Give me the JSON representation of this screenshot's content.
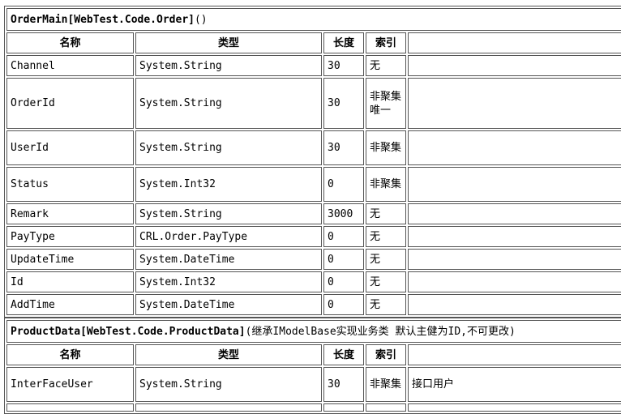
{
  "tables": [
    {
      "title_name": "OrderMain[WebTest.Code.Order]",
      "title_suffix": "()",
      "headers": [
        "名称",
        "类型",
        "长度",
        "索引",
        ""
      ],
      "rows": [
        {
          "name": "Channel",
          "type": "System.String",
          "length": "30",
          "index": "无",
          "note": ""
        },
        {
          "name": "OrderId",
          "type": "System.String",
          "length": "30",
          "index": "非聚集唯一",
          "note": ""
        },
        {
          "name": "UserId",
          "type": "System.String",
          "length": "30",
          "index": "非聚集",
          "note": ""
        },
        {
          "name": "Status",
          "type": "System.Int32",
          "length": "0",
          "index": "非聚集",
          "note": ""
        },
        {
          "name": "Remark",
          "type": "System.String",
          "length": "3000",
          "index": "无",
          "note": ""
        },
        {
          "name": "PayType",
          "type": "CRL.Order.PayType",
          "length": "0",
          "index": "无",
          "note": ""
        },
        {
          "name": "UpdateTime",
          "type": "System.DateTime",
          "length": "0",
          "index": "无",
          "note": ""
        },
        {
          "name": "Id",
          "type": "System.Int32",
          "length": "0",
          "index": "无",
          "note": ""
        },
        {
          "name": "AddTime",
          "type": "System.DateTime",
          "length": "0",
          "index": "无",
          "note": ""
        }
      ]
    },
    {
      "title_name": "ProductData[WebTest.Code.ProductData]",
      "title_suffix": "(继承IModelBase实现业务类 默认主健为ID,不可更改)",
      "headers": [
        "名称",
        "类型",
        "长度",
        "索引",
        ""
      ],
      "rows": [
        {
          "name": "InterFaceUser",
          "type": "System.String",
          "length": "30",
          "index": "非聚集",
          "note": "接口用户"
        }
      ]
    }
  ]
}
